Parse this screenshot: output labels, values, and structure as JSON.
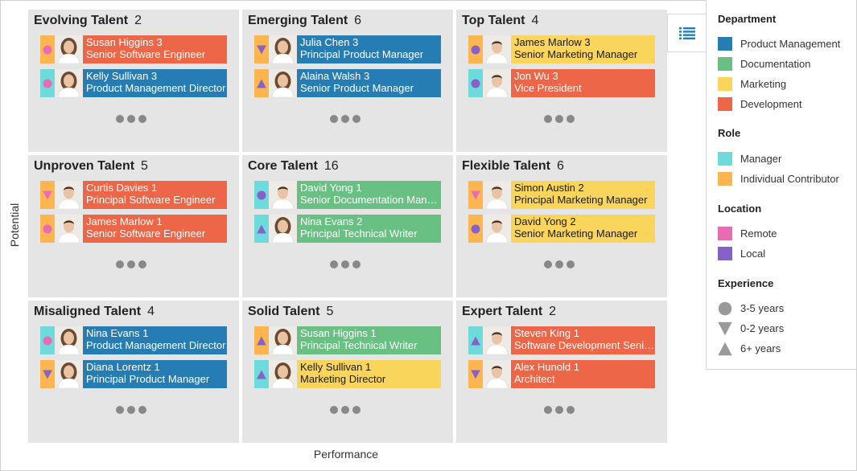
{
  "axes": {
    "x_label": "Performance",
    "y_label": "Potential"
  },
  "colors": {
    "product_management": "#267db3",
    "documentation": "#68c182",
    "marketing": "#fad55c",
    "development": "#ed6647",
    "manager": "#6ddbdb",
    "individual_contributor": "#fdb64f",
    "remote": "#e86cb3",
    "local": "#8561c8",
    "shape": "#999999"
  },
  "legend": {
    "button_icon": "list-icon",
    "sections": [
      {
        "title": "Department",
        "items": [
          {
            "label": "Product Management",
            "color": "#267db3"
          },
          {
            "label": "Documentation",
            "color": "#68c182"
          },
          {
            "label": "Marketing",
            "color": "#fad55c"
          },
          {
            "label": "Development",
            "color": "#ed6647"
          }
        ]
      },
      {
        "title": "Role",
        "items": [
          {
            "label": "Manager",
            "color": "#6ddbdb"
          },
          {
            "label": "Individual Contributor",
            "color": "#fdb64f"
          }
        ]
      },
      {
        "title": "Location",
        "items": [
          {
            "label": "Remote",
            "color": "#e86cb3"
          },
          {
            "label": "Local",
            "color": "#8561c8"
          }
        ]
      },
      {
        "title": "Experience",
        "items": [
          {
            "label": "3-5 years",
            "shape": "circle"
          },
          {
            "label": "0-2 years",
            "shape": "triangle-down"
          },
          {
            "label": "6+ years",
            "shape": "triangle-up"
          }
        ]
      }
    ]
  },
  "cells": [
    {
      "title": "Evolving Talent",
      "count": "2",
      "cards": [
        {
          "name": "Susan Higgins 3",
          "role_title": "Senior Software Engineer",
          "dept": "development",
          "role": "individual_contributor",
          "location": "remote",
          "experience": "circle",
          "gender": "f"
        },
        {
          "name": "Kelly Sullivan 3",
          "role_title": "Product Management Director",
          "dept": "product_management",
          "role": "manager",
          "location": "remote",
          "experience": "circle",
          "gender": "f"
        }
      ]
    },
    {
      "title": "Emerging Talent",
      "count": "6",
      "cards": [
        {
          "name": "Julia Chen 3",
          "role_title": "Principal Product Manager",
          "dept": "product_management",
          "role": "individual_contributor",
          "location": "local",
          "experience": "triangle-down",
          "gender": "f"
        },
        {
          "name": "Alaina Walsh 3",
          "role_title": "Senior Product Manager",
          "dept": "product_management",
          "role": "individual_contributor",
          "location": "local",
          "experience": "triangle-up",
          "gender": "f"
        }
      ]
    },
    {
      "title": "Top Talent",
      "count": "4",
      "cards": [
        {
          "name": "James Marlow 3",
          "role_title": "Senior Marketing Manager",
          "dept": "marketing",
          "role": "individual_contributor",
          "location": "local",
          "experience": "circle",
          "gender": "m"
        },
        {
          "name": "Jon Wu 3",
          "role_title": "Vice President",
          "dept": "development",
          "role": "manager",
          "location": "local",
          "experience": "circle",
          "gender": "m"
        }
      ]
    },
    {
      "title": "Unproven Talent",
      "count": "5",
      "cards": [
        {
          "name": "Curtis Davies 1",
          "role_title": "Principal Software Engineer",
          "dept": "development",
          "role": "individual_contributor",
          "location": "remote",
          "experience": "triangle-down",
          "gender": "m"
        },
        {
          "name": "James Marlow 1",
          "role_title": "Senior Software Engineer",
          "dept": "development",
          "role": "individual_contributor",
          "location": "remote",
          "experience": "circle",
          "gender": "m"
        }
      ]
    },
    {
      "title": "Core Talent",
      "count": "16",
      "cards": [
        {
          "name": "David Yong 1",
          "role_title": "Senior Documentation Manager",
          "dept": "documentation",
          "role": "manager",
          "location": "local",
          "experience": "circle",
          "gender": "m"
        },
        {
          "name": "Nina Evans 2",
          "role_title": "Principal Technical Writer",
          "dept": "documentation",
          "role": "manager",
          "location": "local",
          "experience": "triangle-up",
          "gender": "f"
        }
      ]
    },
    {
      "title": "Flexible Talent",
      "count": "6",
      "cards": [
        {
          "name": "Simon Austin 2",
          "role_title": "Principal Marketing Manager",
          "dept": "marketing",
          "role": "individual_contributor",
          "location": "remote",
          "experience": "triangle-down",
          "gender": "m"
        },
        {
          "name": "David Yong 2",
          "role_title": "Senior Marketing Manager",
          "dept": "marketing",
          "role": "individual_contributor",
          "location": "local",
          "experience": "circle",
          "gender": "m"
        }
      ]
    },
    {
      "title": "Misaligned Talent",
      "count": "4",
      "cards": [
        {
          "name": "Nina Evans 1",
          "role_title": "Product Management Director",
          "dept": "product_management",
          "role": "manager",
          "location": "remote",
          "experience": "circle",
          "gender": "f"
        },
        {
          "name": "Diana Lorentz 1",
          "role_title": "Principal Product Manager",
          "dept": "product_management",
          "role": "individual_contributor",
          "location": "local",
          "experience": "triangle-down",
          "gender": "f"
        }
      ]
    },
    {
      "title": "Solid Talent",
      "count": "5",
      "cards": [
        {
          "name": "Susan Higgins 1",
          "role_title": "Principal Technical Writer",
          "dept": "documentation",
          "role": "individual_contributor",
          "location": "local",
          "experience": "triangle-up",
          "gender": "f"
        },
        {
          "name": "Kelly Sullivan 1",
          "role_title": "Marketing Director",
          "dept": "marketing",
          "role": "manager",
          "location": "local",
          "experience": "triangle-up",
          "gender": "f"
        }
      ]
    },
    {
      "title": "Expert Talent",
      "count": "2",
      "cards": [
        {
          "name": "Steven King 1",
          "role_title": "Software Development Senior Director",
          "dept": "development",
          "role": "manager",
          "location": "local",
          "experience": "triangle-up",
          "gender": "m"
        },
        {
          "name": "Alex Hunold 1",
          "role_title": "Architect",
          "dept": "development",
          "role": "individual_contributor",
          "location": "local",
          "experience": "triangle-down",
          "gender": "m"
        }
      ]
    }
  ]
}
